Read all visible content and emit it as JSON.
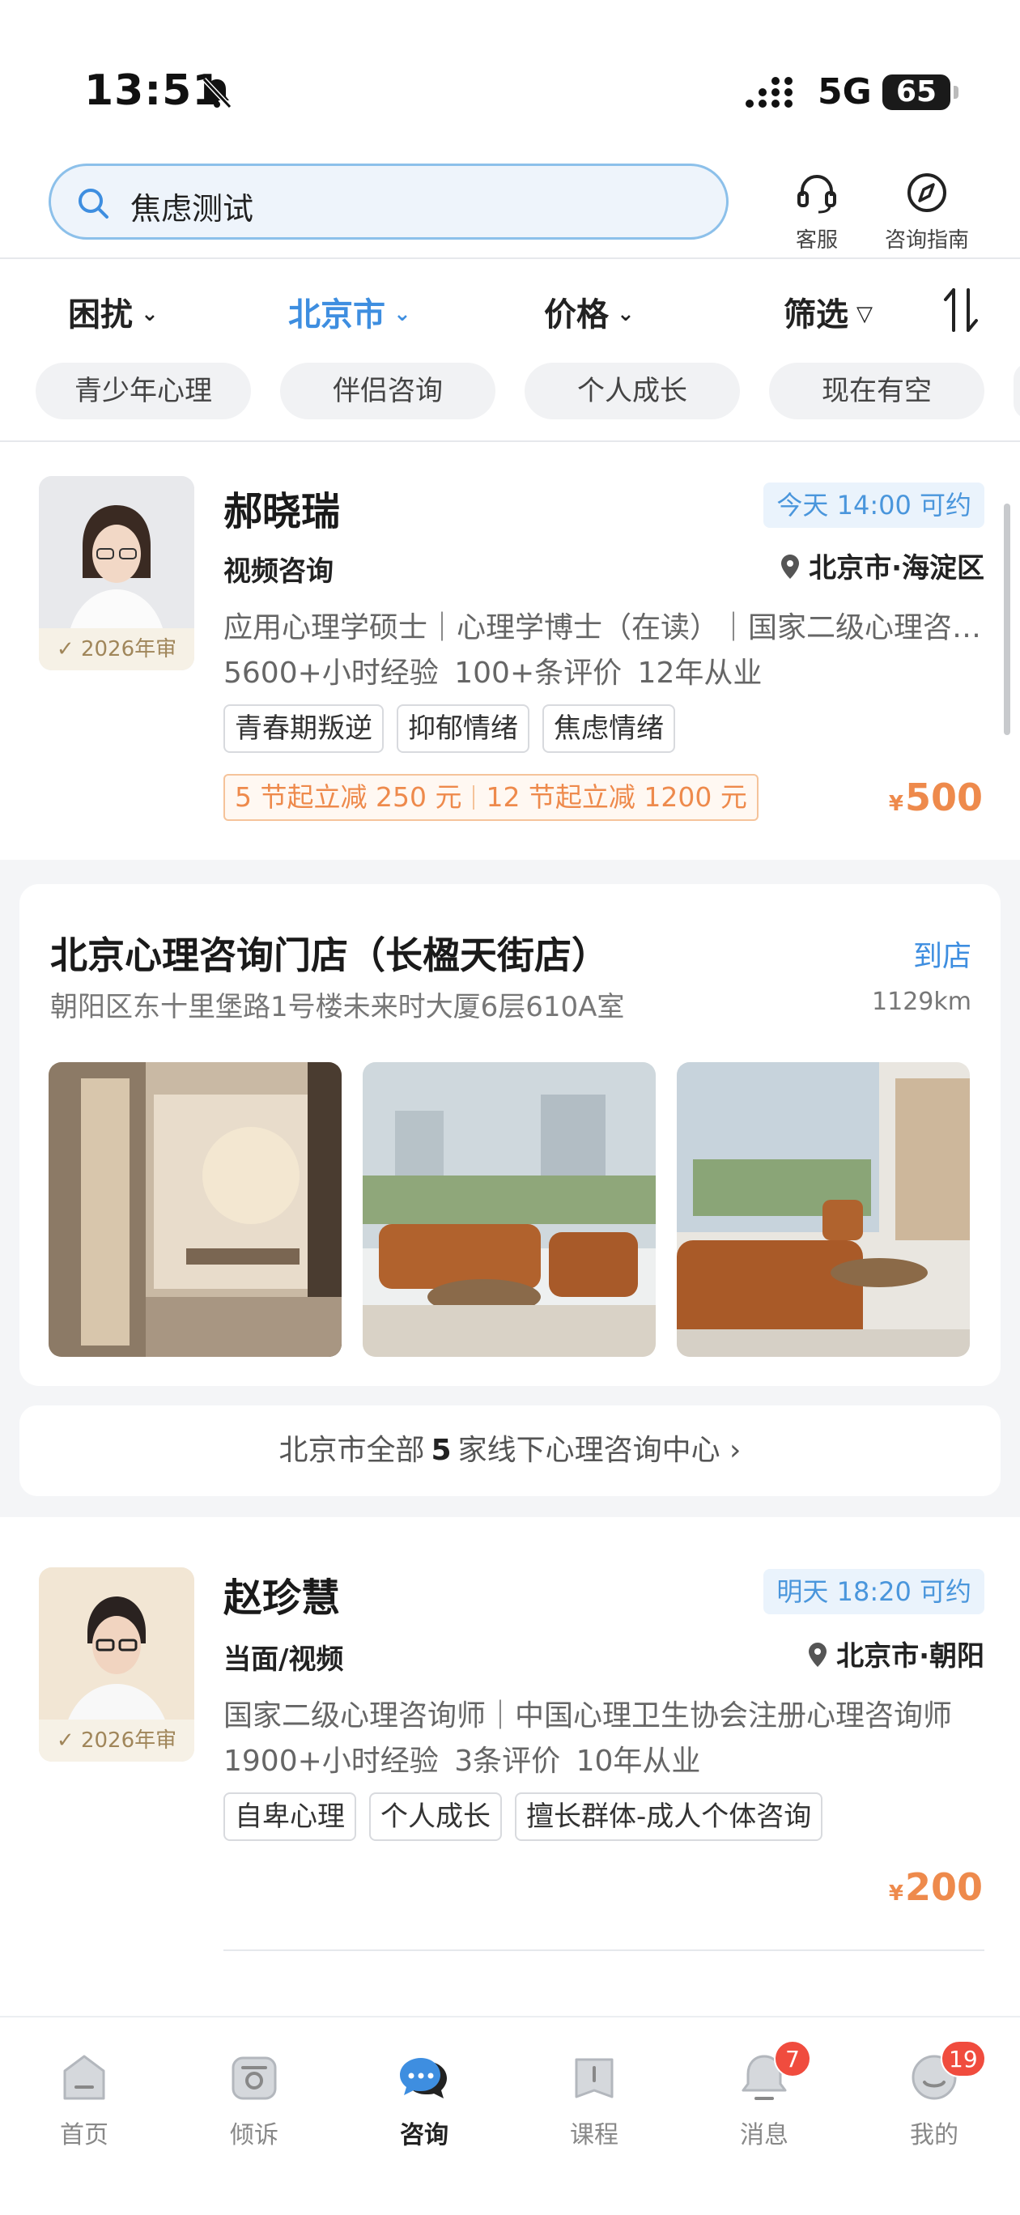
{
  "status_bar": {
    "time": "13:51",
    "network": "5G",
    "battery": "65"
  },
  "search": {
    "value": "焦虑测试"
  },
  "top_actions": [
    {
      "label": "客服",
      "icon": "headset-icon"
    },
    {
      "label": "咨询指南",
      "icon": "compass-icon"
    }
  ],
  "filters": {
    "trouble": "困扰",
    "city": "北京市",
    "price": "价格",
    "screen": "筛选"
  },
  "chips": [
    "青少年心理",
    "伴侣咨询",
    "个人成长",
    "现在有空"
  ],
  "counselors": [
    {
      "name": "郝晓瑞",
      "availability": "今天 14:00 可约",
      "mode": "视频咨询",
      "location": "北京市·海淀区",
      "qualifications": "应用心理学硕士｜心理学博士（在读）｜国家二级心理咨询师",
      "stats": "5600+小时经验  100+条评价  12年从业",
      "tags": [
        "青春期叛逆",
        "抑郁情绪",
        "焦虑情绪"
      ],
      "promo_1": "5 节起立减 250 元",
      "promo_2": "12 节起立减 1200 元",
      "badge": "2026年审",
      "currency": "¥",
      "price": "500"
    },
    {
      "name": "赵珍慧",
      "availability": "明天 18:20 可约",
      "mode": "当面/视频",
      "location": "北京市·朝阳",
      "qualifications": "国家二级心理咨询师｜中国心理卫生协会注册心理咨询师",
      "stats": "1900+小时经验  3条评价  10年从业",
      "tags": [
        "自卑心理",
        "个人成长",
        "擅长群体-成人个体咨询"
      ],
      "badge": "2026年审",
      "currency": "¥",
      "price": "200"
    }
  ],
  "store": {
    "title": "北京心理咨询门店（长楹天街店）",
    "action": "到店",
    "address": "朝阳区东十里堡路1号楼未来时大厦6层610A室",
    "distance": "1129km",
    "more_prefix": "北京市全部",
    "more_count": "5",
    "more_suffix": "家线下心理咨询中心 ›"
  },
  "tabbar": [
    {
      "label": "首页",
      "icon": "home-icon"
    },
    {
      "label": "倾诉",
      "icon": "phone-icon"
    },
    {
      "label": "咨询",
      "icon": "chat-icon",
      "active": true
    },
    {
      "label": "课程",
      "icon": "book-icon"
    },
    {
      "label": "消息",
      "icon": "bell-icon",
      "badge": "7"
    },
    {
      "label": "我的",
      "icon": "smile-icon",
      "badge": "19"
    }
  ],
  "colors": {
    "accent": "#3e8ee0",
    "price": "#ee8a4c",
    "badge_red": "#f04c3e"
  }
}
